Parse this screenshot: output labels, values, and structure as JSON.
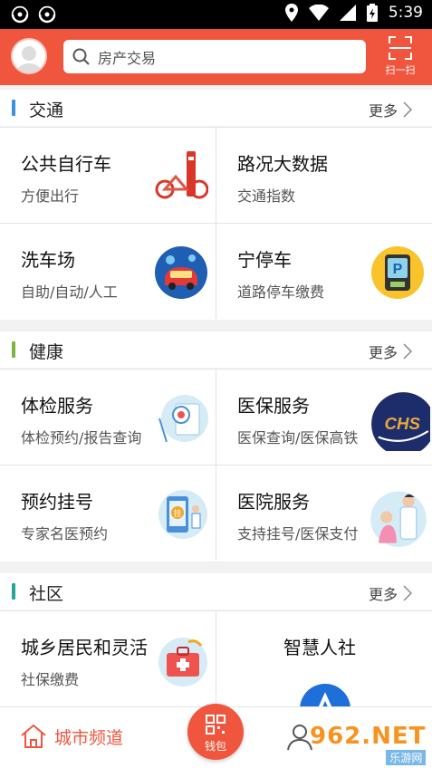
{
  "status_bar": {
    "time": "5:39"
  },
  "header": {
    "search_placeholder": "房产交易",
    "scan_label": "扫一扫"
  },
  "sections": {
    "traffic": {
      "title": "交通",
      "more": "更多",
      "items": [
        {
          "title": "公共自行车",
          "subtitle": "方便出行"
        },
        {
          "title": "路况大数据",
          "subtitle": "交通指数"
        },
        {
          "title": "洗车场",
          "subtitle": "自助/自动/人工"
        },
        {
          "title": "宁停车",
          "subtitle": "道路停车缴费"
        }
      ]
    },
    "health": {
      "title": "健康",
      "more": "更多",
      "items": [
        {
          "title": "体检服务",
          "subtitle": "体检预约/报告查询"
        },
        {
          "title": "医保服务",
          "subtitle": "医保查询/医保高铁"
        },
        {
          "title": "预约挂号",
          "subtitle": "专家名医预约"
        },
        {
          "title": "医院服务",
          "subtitle": "支持挂号/医保支付"
        }
      ]
    },
    "community": {
      "title": "社区",
      "more": "更多",
      "items": [
        {
          "title": "城乡居民和灵活",
          "subtitle": "社保缴费"
        },
        {
          "title": "智慧人社",
          "subtitle": ""
        }
      ]
    }
  },
  "icons": {
    "hospital_badge": "挂",
    "parking_letter": "P",
    "chs_text": "CHS"
  },
  "bottom_nav": {
    "home_label": "城市频道",
    "wallet_label": "钱包"
  },
  "watermark": {
    "big": "962.NET",
    "small": "乐游网"
  },
  "colors": {
    "brand": "#f0563e",
    "traffic_bar": "#3d8fe0",
    "health_bar": "#7cb342",
    "community_bar": "#26a69a"
  }
}
